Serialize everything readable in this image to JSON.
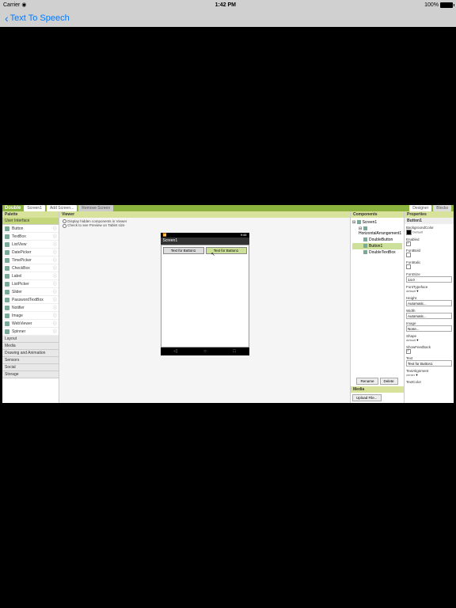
{
  "ios": {
    "carrier": "Carrier",
    "time": "1:42 PM",
    "battery": "100%",
    "navTitle": "Text To Speech"
  },
  "appinv": {
    "projectName": "Double",
    "screenBtn": "Screen1",
    "addScreen": "Add Screen...",
    "removeScreen": "Remove Screen",
    "modeDesigner": "Designer",
    "modeBlocks": "Blocks",
    "palette": {
      "title": "Palette",
      "cats": [
        "User Interface",
        "Layout",
        "Media",
        "Drawing and Animation",
        "Sensors",
        "Social",
        "Storage"
      ],
      "items": [
        "Button",
        "TextBox",
        "ListView",
        "DatePicker",
        "TimePicker",
        "CheckBox",
        "Label",
        "ListPicker",
        "Slider",
        "PasswordTextBox",
        "Notifier",
        "Image",
        "WebViewer",
        "Spinner"
      ]
    },
    "viewer": {
      "title": "Viewer",
      "opt1": "Display hidden components in Viewer",
      "opt2": "Check to see Preview on Tablet size",
      "phoneTime": "9:48",
      "screenTitle": "Screen1",
      "btn1": "Text for Button1",
      "btn2": "Text for Button1"
    },
    "components": {
      "title": "Components",
      "tree": {
        "screen": "Screen1",
        "harr": "HorizontalArrangement1",
        "dbtn": "DoubleButton",
        "btn1": "Button1",
        "dtb": "DoubleTextBox"
      },
      "rename": "Rename",
      "delete": "Delete",
      "mediaTitle": "Media",
      "upload": "Upload File..."
    },
    "properties": {
      "title": "Properties",
      "selected": "Button1",
      "items": {
        "bgColor": "BackgroundColor",
        "bgColorVal": "Default",
        "enabled": "Enabled",
        "fontBold": "FontBold",
        "fontItalic": "FontItalic",
        "fontSize": "FontSize",
        "fontSizeVal": "14.0",
        "fontTypeface": "FontTypeface",
        "fontTypefaceVal": "default",
        "height": "Height",
        "heightVal": "Automatic...",
        "width": "Width",
        "widthVal": "Automatic...",
        "image": "Image",
        "imageVal": "None...",
        "shape": "Shape",
        "shapeVal": "default",
        "showFeedback": "ShowFeedback",
        "text": "Text",
        "textVal": "Text for Button1",
        "textAlignment": "TextAlignment",
        "textAlignmentVal": "center",
        "textColor": "TextColor"
      }
    }
  }
}
